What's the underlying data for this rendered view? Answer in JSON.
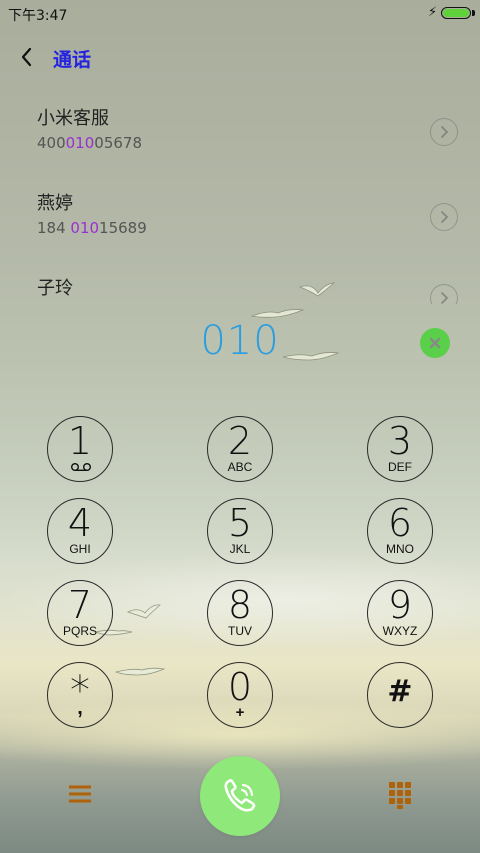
{
  "status_bar": {
    "time": "下午3:47",
    "battery_level": 1.0,
    "charging": true,
    "battery_color": "#5fd13b"
  },
  "header": {
    "title": "通话",
    "title_color": "#2323e0",
    "back_icon": "chevron-left-icon"
  },
  "contacts": [
    {
      "name": "小米客服",
      "number_pre": "400",
      "number_match": "010",
      "number_post": "05678"
    },
    {
      "name": "燕婷",
      "number_pre": "184 ",
      "number_match": "010",
      "number_post": "15689"
    },
    {
      "name": "子玲",
      "number_pre": "",
      "number_match": "",
      "number_post": ""
    }
  ],
  "highlight_color": "#9a2fd0",
  "dialed_number": "010",
  "dialed_color": "#2a9de0",
  "clear_button_color": "#5ad04a",
  "keypad": [
    {
      "digit": "1",
      "letters": "",
      "sub_icon": "voicemail-icon"
    },
    {
      "digit": "2",
      "letters": "ABC"
    },
    {
      "digit": "3",
      "letters": "DEF"
    },
    {
      "digit": "4",
      "letters": "GHI"
    },
    {
      "digit": "5",
      "letters": "JKL"
    },
    {
      "digit": "6",
      "letters": "MNO"
    },
    {
      "digit": "7",
      "letters": "PQRS"
    },
    {
      "digit": "8",
      "letters": "TUV"
    },
    {
      "digit": "9",
      "letters": "WXYZ"
    },
    {
      "digit": "*",
      "letters": ","
    },
    {
      "digit": "0",
      "letters": "+"
    },
    {
      "digit": "#",
      "letters": ""
    }
  ],
  "bottom_bar": {
    "menu_icon": "menu-icon",
    "call_icon": "phone-wifi-call-icon",
    "dialpad_icon": "dialpad-icon",
    "accent_color": "#b0620a",
    "call_color": "#8ee87a"
  }
}
